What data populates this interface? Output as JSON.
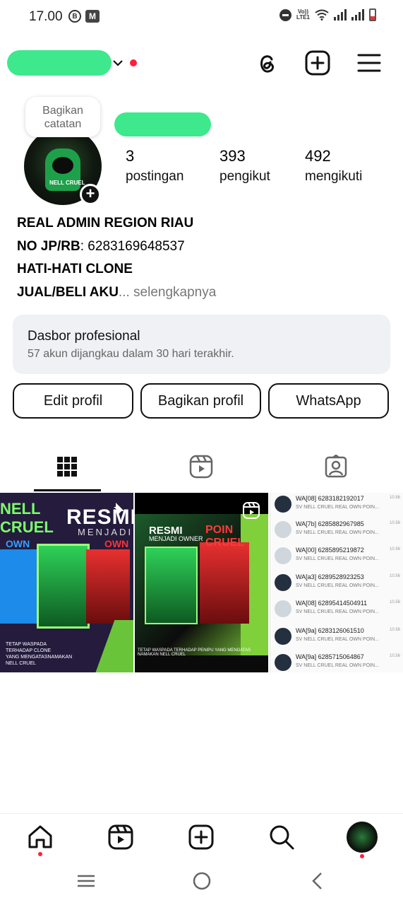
{
  "status_bar": {
    "time": "17.00",
    "left_icons": [
      "b-circle-icon",
      "m-app-icon"
    ],
    "right_icons": [
      "dnd-icon",
      "volte-icon",
      "wifi-icon",
      "signal-icon",
      "signal-icon",
      "battery-low-icon"
    ],
    "volte_label": "Vo))\nLTE1"
  },
  "header": {
    "username_redacted": true,
    "icons": [
      "threads-icon",
      "create-post-icon",
      "menu-icon"
    ]
  },
  "profile": {
    "note_bubble": "Bagikan catatan",
    "stats": [
      {
        "number": "3",
        "label": "postingan"
      },
      {
        "number": "393",
        "label": "pengikut"
      },
      {
        "number": "492",
        "label": "mengikuti"
      }
    ],
    "bio": {
      "line1": "REAL ADMIN REGION RIAU",
      "line2_bold": "NO JP/RB",
      "line2_rest": ": 6283169648537",
      "line3": "HATI-HATI CLONE",
      "line4": "JUAL/BELI AKU",
      "more": "... selengkapnya"
    }
  },
  "dashboard": {
    "title": "Dasbor profesional",
    "subtitle": "57 akun dijangkau dalam 30 hari terakhir."
  },
  "buttons": {
    "edit": "Edit profil",
    "share": "Bagikan profil",
    "whatsapp": "WhatsApp"
  },
  "tabs": [
    "grid-icon",
    "reels-icon",
    "tagged-icon"
  ],
  "posts": {
    "post1": {
      "banner": "NELL CRUEL",
      "title": "RESMI",
      "subtitle": "MENJADI",
      "own_left": "OWN",
      "own_right": "OWN",
      "footer": "TETAP WASPADA\nTERHADAP CLONE\nYANG MENGATASNAMAKAN\nNELL CRUEL"
    },
    "post2": {
      "title": "RESMI",
      "subtitle": "MENJADI OWNER",
      "right_title": "POIN CRUEL",
      "footer": "TETAP WASPADA TERHADAP PENIPU YANG MENGATAS NAMAKAN NELL CRUEL"
    },
    "post3": {
      "chats": [
        {
          "name": "WA[08] 6283182192017",
          "msg": "SV NELL CRUEL REAL OWN POIN...",
          "time": "10.56"
        },
        {
          "name": "WA[7b] 6285882967985",
          "msg": "SV NELL CRUEL REAL OWN POIN...",
          "time": "10.56"
        },
        {
          "name": "WA[00] 6285895219872",
          "msg": "SV NELL CRUEL REAL OWN POIN...",
          "time": "10.56"
        },
        {
          "name": "WA[a3] 6289528923253",
          "msg": "SV NELL CRUEL REAL OWN POIN...",
          "time": "10.56"
        },
        {
          "name": "WA[08] 62895414504911",
          "msg": "SV NELL CRUEL REAL OWN POIN...",
          "time": "10.56"
        },
        {
          "name": "WA[9a] 6283126061510",
          "msg": "SV NELL CRUEL REAL OWN POIN...",
          "time": "10.56"
        },
        {
          "name": "WA[9a] 6285715064867",
          "msg": "SV NELL CRUEL REAL OWN POIN...",
          "time": "10.56"
        }
      ]
    }
  },
  "bottom_nav": [
    "home-icon",
    "reels-icon",
    "create-icon",
    "search-icon",
    "profile-avatar"
  ],
  "colors": {
    "redaction": "#3ee88c",
    "notification": "#ff1f3d",
    "dashboard_bg": "#eff1f4"
  }
}
